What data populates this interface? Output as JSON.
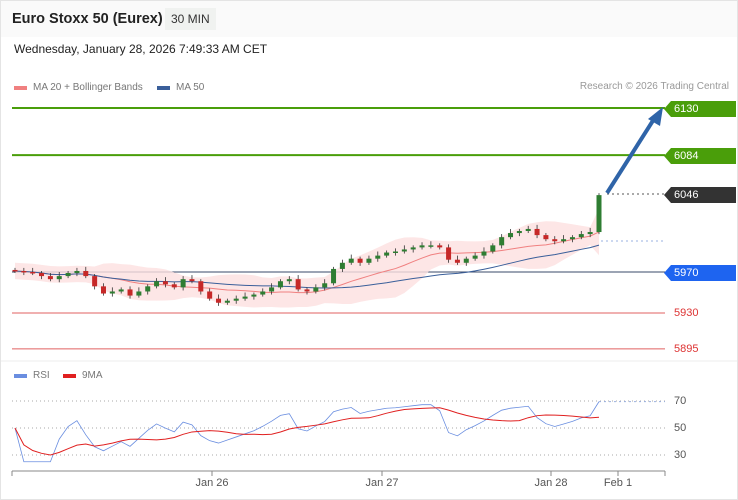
{
  "header": {
    "title": "Euro Stoxx 50 (Eurex)",
    "interval": "30 MIN",
    "datetime": "Wednesday, January 28, 2026 7:49:33 AM CET"
  },
  "legend": {
    "ma20": "MA 20 + Bollinger Bands",
    "ma50": "MA 50",
    "rsi": "RSI",
    "rsi_ma": "9MA"
  },
  "credit": "Research © 2026 Trading Central",
  "colors": {
    "resistance": "#4a9e0a",
    "support": "#1e64f0",
    "pivot": "#333333",
    "red_level": "#e06060",
    "ma20": "#f08080",
    "ma50": "#3a5f9a",
    "rsi": "#6a8ee0",
    "rsi_ma": "#e02020",
    "up": "#2e7d32",
    "down": "#c62828"
  },
  "levels": {
    "r2": "6130",
    "r1": "6084",
    "last": "6046",
    "pivot": "5970",
    "s1": "5930",
    "s2": "5895"
  },
  "rsi_axis": [
    "70",
    "50",
    "30"
  ],
  "x_axis": [
    "Jan 26",
    "Jan 27",
    "Jan 28",
    "Feb 1"
  ],
  "chart_data": {
    "type": "candlestick",
    "ylim": [
      5880,
      6140
    ],
    "closes": [
      5971,
      5970,
      5969,
      5966,
      5963,
      5966,
      5969,
      5971,
      5966,
      5956,
      5949,
      5951,
      5953,
      5947,
      5951,
      5956,
      5961,
      5958,
      5955,
      5963,
      5961,
      5951,
      5944,
      5940,
      5942,
      5944,
      5946,
      5948,
      5951,
      5955,
      5961,
      5963,
      5953,
      5951,
      5955,
      5959,
      5973,
      5979,
      5983,
      5979,
      5983,
      5986,
      5989,
      5990,
      5992,
      5994,
      5996,
      5996,
      5994,
      5982,
      5979,
      5983,
      5986,
      5990,
      5996,
      6004,
      6008,
      6010,
      6012,
      6006,
      6002,
      6000,
      6002,
      6004,
      6007,
      6009,
      6045
    ],
    "rsi_ylim": [
      20,
      80
    ]
  }
}
